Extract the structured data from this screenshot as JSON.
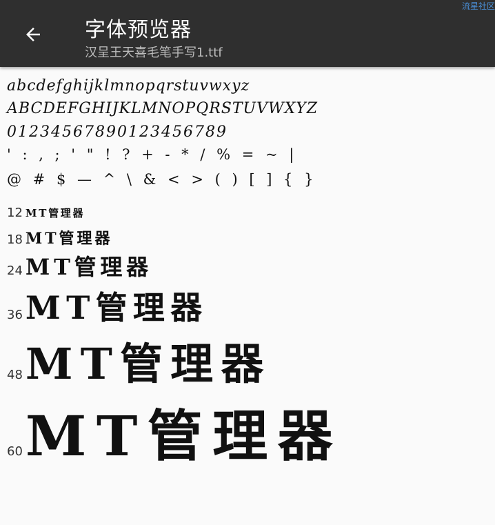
{
  "watermark": "流星社区",
  "header": {
    "title": "字体预览器",
    "subtitle": "汉呈王天喜毛笔手写1.ttf"
  },
  "charset": {
    "lower": "abcdefghijklmnopqrstuvwxyz",
    "upper": "ABCDEFGHIJKLMNOPQRSTUVWXYZ",
    "digits": "01234567890123456789",
    "punct1": "' : , ; ' \" ! ? + - * / % = ~ |",
    "punct2": "@ # $ — ^ \\ & < > ( ) [ ] { }"
  },
  "samples": [
    {
      "size": "12",
      "text": "MT管理器"
    },
    {
      "size": "18",
      "text": "MT管理器"
    },
    {
      "size": "24",
      "text": "MT管理器"
    },
    {
      "size": "36",
      "text": "MT管理器"
    },
    {
      "size": "48",
      "text": "MT管理器"
    },
    {
      "size": "60",
      "text": "MT管理器"
    }
  ]
}
